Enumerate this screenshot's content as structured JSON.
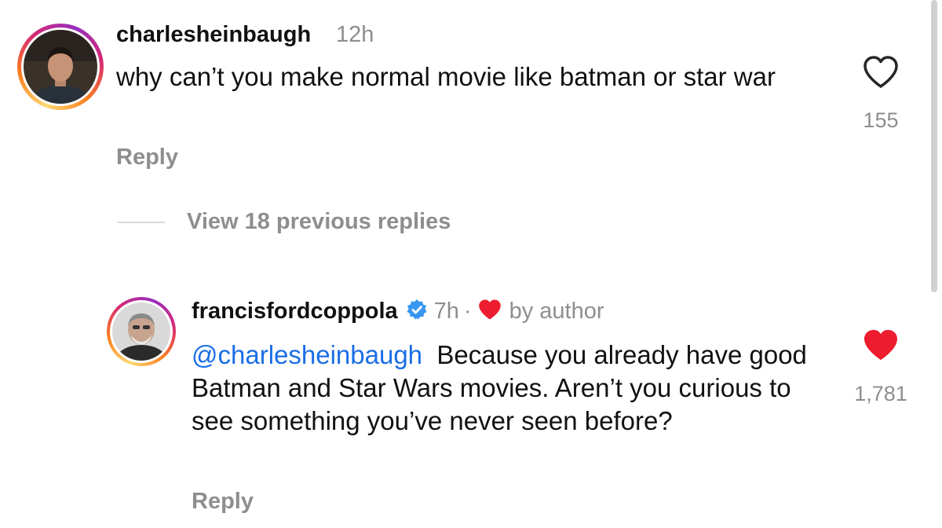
{
  "comment": {
    "username": "charlesheinbaugh",
    "time": "12h",
    "text": "why can’t you make normal movie like batman or star war",
    "like_count": "155",
    "liked": false,
    "reply_label": "Reply"
  },
  "thread": {
    "view_replies_label": "View 18 previous replies"
  },
  "reply": {
    "username": "francisfordcoppola",
    "verified": true,
    "time": "7h",
    "separator": "·",
    "by_author_label": "by author",
    "mention": "@charlesheinbaugh",
    "text": "Because you already have good Batman and Star Wars movies. Aren’t you curious  to see something you’ve never seen before?",
    "like_count": "1,781",
    "liked": true,
    "reply_label": "Reply"
  },
  "icons": {
    "like": "heart-outline-icon",
    "liked": "heart-filled-icon",
    "verified": "verified-badge-icon"
  },
  "colors": {
    "mention": "#1a6ee6",
    "like_red": "#ed1c2e",
    "verified_blue": "#3897f0",
    "muted": "#8e8e8e"
  }
}
